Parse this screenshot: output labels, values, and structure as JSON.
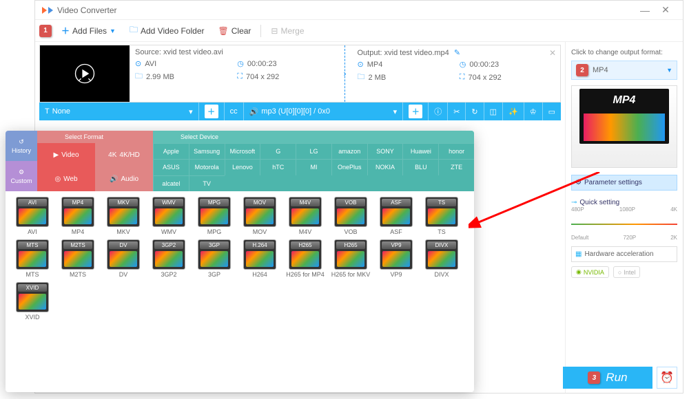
{
  "titlebar": {
    "title": "Video Converter"
  },
  "toolbar": {
    "add_files": "Add Files",
    "add_folder": "Add Video Folder",
    "clear": "Clear",
    "merge": "Merge"
  },
  "file": {
    "source_prefix": "Source:",
    "source_name": "xvid test video.avi",
    "output_prefix": "Output:",
    "output_name": "xvid test video.mp4",
    "src_format": "AVI",
    "src_duration": "00:00:23",
    "src_size": "2.99 MB",
    "src_dim": "704 x 292",
    "out_format": "MP4",
    "out_duration": "00:00:23",
    "out_size": "2 MB",
    "out_dim": "704 x 292"
  },
  "subbar": {
    "subtitle": "None",
    "audio_track": "mp3 (U[0][0][0] / 0x0"
  },
  "right": {
    "change_hint": "Click to change output format:",
    "selected_format": "MP4",
    "preview_label": "MP4",
    "param_btn": "Parameter settings",
    "quick_setting": "Quick setting",
    "q_480": "480P",
    "q_720": "720P",
    "q_1080": "1080P",
    "q_2k": "2K",
    "q_4k": "4K",
    "q_default": "Default",
    "hw_btn": "Hardware acceleration",
    "chip_nvidia": "NVIDIA",
    "chip_intel": "Intel",
    "run": "Run"
  },
  "panel": {
    "side": {
      "history": "History",
      "custom": "Custom"
    },
    "select_format": "Select Format",
    "select_device": "Select Device",
    "cats": {
      "video": "Video",
      "fourk": "4K/HD",
      "web": "Web",
      "audio": "Audio"
    },
    "devices_row1": [
      "Apple",
      "Samsung",
      "Microsoft",
      "G",
      "LG",
      "amazon",
      "SONY",
      "Huawei",
      "honor"
    ],
    "devices_row1b": [
      "ASUS"
    ],
    "devices_row2": [
      "Motorola",
      "Lenovo",
      "hTC",
      "MI",
      "OnePlus",
      "NOKIA",
      "BLU",
      "ZTE",
      "alcatel",
      "TV"
    ],
    "formats_row1": [
      "AVI",
      "MP4",
      "MKV",
      "WMV",
      "MPG",
      "MOV",
      "M4V",
      "VOB",
      "ASF",
      "TS"
    ],
    "formats_row2": [
      "MTS",
      "M2TS",
      "DV",
      "3GP2",
      "3GP",
      "H264",
      "H265 for MP4",
      "H265 for MKV",
      "VP9",
      "DIVX"
    ],
    "formats_row3": [
      "XVID"
    ],
    "tags_row1": [
      "AVI",
      "MP4",
      "MKV",
      "WMV",
      "MPG",
      "MOV",
      "M4V",
      "VOB",
      "ASF",
      "TS"
    ],
    "tags_row2": [
      "MTS",
      "M2TS",
      "DV",
      "3GP2",
      "3GP",
      "H.264",
      "H265",
      "H265",
      "VP9",
      "DIVX"
    ],
    "tags_row3": [
      "XVID"
    ]
  },
  "badges": {
    "b1": "1",
    "b2": "2",
    "b3": "3"
  }
}
